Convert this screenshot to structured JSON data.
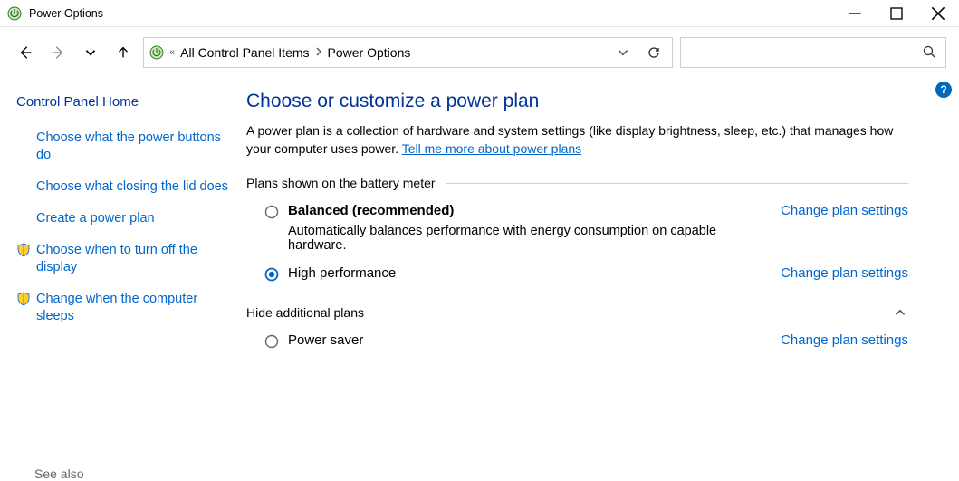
{
  "window": {
    "title": "Power Options"
  },
  "breadcrumb": {
    "overflow": "«",
    "segments": [
      "All Control Panel Items",
      "Power Options"
    ]
  },
  "search": {
    "value": ""
  },
  "sidebar": {
    "home": "Control Panel Home",
    "tasks": [
      {
        "label": "Choose what the power buttons do",
        "has_icon": false
      },
      {
        "label": "Choose what closing the lid does",
        "has_icon": false
      },
      {
        "label": "Create a power plan",
        "has_icon": false
      },
      {
        "label": "Choose when to turn off the display",
        "has_icon": true
      },
      {
        "label": "Change when the computer sleeps",
        "has_icon": true
      }
    ],
    "see_also_label": "See also"
  },
  "main": {
    "heading": "Choose or customize a power plan",
    "lead_prefix": "A power plan is a collection of hardware and system settings (like display brightness, sleep, etc.) that manages how your computer uses power. ",
    "lead_link": "Tell me more about power plans",
    "section1_title": "Plans shown on the battery meter",
    "plans": [
      {
        "name": "Balanced (recommended)",
        "desc": "Automatically balances performance with energy consumption on capable hardware.",
        "selected": false,
        "bold": true,
        "change_label": "Change plan settings"
      },
      {
        "name": "High performance",
        "desc": "",
        "selected": true,
        "bold": false,
        "change_label": "Change plan settings"
      }
    ],
    "section2_title": "Hide additional plans",
    "extra_plans": [
      {
        "name": "Power saver",
        "desc": "",
        "selected": false,
        "bold": false,
        "change_label": "Change plan settings"
      }
    ]
  }
}
